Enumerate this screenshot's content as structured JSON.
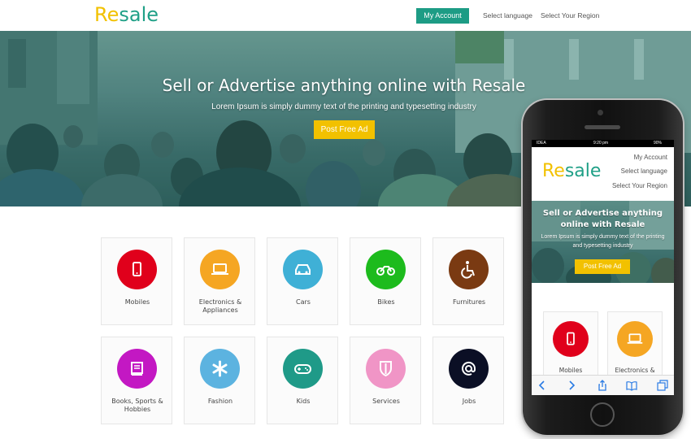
{
  "header": {
    "logo_part1": "Re",
    "logo_part2": "sale",
    "my_account": "My Account",
    "select_language": "Select language",
    "select_region": "Select Your Region"
  },
  "hero": {
    "title": "Sell or Advertise anything online with Resale",
    "subtitle": "Lorem Ipsum is simply dummy text of the printing and typesetting industry",
    "cta": "Post Free Ad"
  },
  "categories": [
    {
      "label": "Mobiles",
      "icon": "mobile-icon",
      "color": "#e0001b"
    },
    {
      "label": "Electronics & Appliances",
      "icon": "laptop-icon",
      "color": "#f5a623"
    },
    {
      "label": "Cars",
      "icon": "car-icon",
      "color": "#3fb0d6"
    },
    {
      "label": "Bikes",
      "icon": "motorbike-icon",
      "color": "#1dbb1d"
    },
    {
      "label": "Furnitures",
      "icon": "wheelchair-icon",
      "color": "#7a3a12"
    },
    {
      "label": "Books, Sports & Hobbies",
      "icon": "book-icon",
      "color": "#c318c3"
    },
    {
      "label": "Fashion",
      "icon": "asterisk-icon",
      "color": "#5cb3e0"
    },
    {
      "label": "Kids",
      "icon": "gamepad-icon",
      "color": "#1f9a88"
    },
    {
      "label": "Services",
      "icon": "shield-icon",
      "color": "#f095c6"
    },
    {
      "label": "Jobs",
      "icon": "at-icon",
      "color": "#0b0f25"
    }
  ],
  "phone": {
    "status_carrier": "IDEA",
    "status_time": "9:20 pm",
    "status_battery": "90%",
    "nav_my_account": "My Account",
    "nav_select_language": "Select language",
    "nav_select_region": "Select Your Region",
    "hero_title": "Sell or Advertise anything online with Resale",
    "hero_subtitle": "Lorem Ipsum is simply dummy text of the printing and typesetting industry",
    "hero_cta": "Post Free Ad",
    "categories": [
      {
        "label": "Mobiles",
        "icon": "mobile-icon",
        "color": "#e0001b"
      },
      {
        "label": "Electronics &",
        "icon": "laptop-icon",
        "color": "#f5a623"
      }
    ],
    "toolbar": [
      "back-icon",
      "forward-icon",
      "share-icon",
      "bookmarks-icon",
      "tabs-icon"
    ]
  }
}
